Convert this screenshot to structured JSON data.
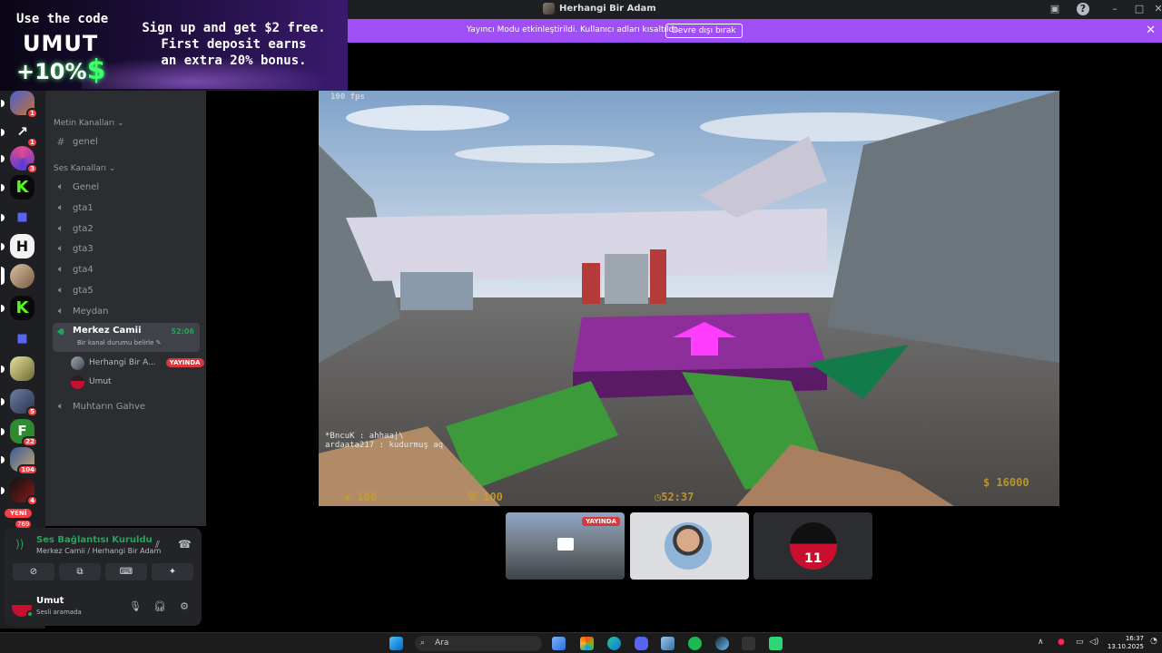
{
  "promo": {
    "code_label": "Use the code",
    "code": "UMUT",
    "bonus": "+10%",
    "bonus_symbol": "$",
    "line1": "Sign up and get $2 free.",
    "line2": "First deposit earns",
    "line3": "an extra 20% bonus."
  },
  "window": {
    "title": "Herhangi Bir Adam"
  },
  "banner": {
    "text": "Yayıncı Modu etkinleştirildi. Kullanıcı adları kısaltıldı.",
    "button": "Devre dışı bırak",
    "color": "#a04ef6"
  },
  "servers": [
    {
      "badge": "1"
    },
    {
      "badge": "1"
    },
    {
      "badge": "3"
    },
    {
      "badge": ""
    },
    {
      "badge": ""
    },
    {
      "badge": ""
    },
    {
      "badge": ""
    },
    {
      "badge": ""
    },
    {
      "badge": ""
    },
    {
      "badge": ""
    },
    {
      "badge": "5"
    },
    {
      "badge": "22"
    },
    {
      "badge": "104"
    },
    {
      "badge": "4"
    }
  ],
  "rail": {
    "new_label": "YENİ",
    "new_count": "769"
  },
  "channels": {
    "text_category": "Metin Kanalları",
    "text_channels": [
      "genel"
    ],
    "voice_category": "Ses Kanalları",
    "voice_channels": [
      "Genel",
      "gta1",
      "gta2",
      "gta3",
      "gta4",
      "gta5",
      "Meydan"
    ],
    "active_channel": {
      "name": "Merkez Camii",
      "timer": "52:06",
      "status": "Bir kanal durumu belirle"
    },
    "members": [
      {
        "name": "Herhangi Bir A...",
        "live": "YAYINDA"
      },
      {
        "name": "Umut",
        "live": ""
      }
    ],
    "extra_channel": "Muhtarın Gahve"
  },
  "voice_panel": {
    "status": "Ses Bağlantısı Kuruldu",
    "location": "Merkez Camii / Herhangi Bir Adam",
    "user": "Umut",
    "user_status": "Sesli aramada"
  },
  "stream": {
    "fps": "100 fps",
    "chat_line1": "*BncuK :  ahhaa|\\",
    "chat_line2": "ardaata217 :  kudurmuş aq",
    "hud_health": "100",
    "hud_armor": "100",
    "hud_time": "52:37",
    "hud_money": "16000"
  },
  "thumbnails": [
    {
      "label": "YAYINDA"
    },
    {
      "label": ""
    },
    {
      "label": "11"
    }
  ],
  "taskbar": {
    "search": "Ara",
    "time": "16:37",
    "date": "13.10.2025"
  }
}
